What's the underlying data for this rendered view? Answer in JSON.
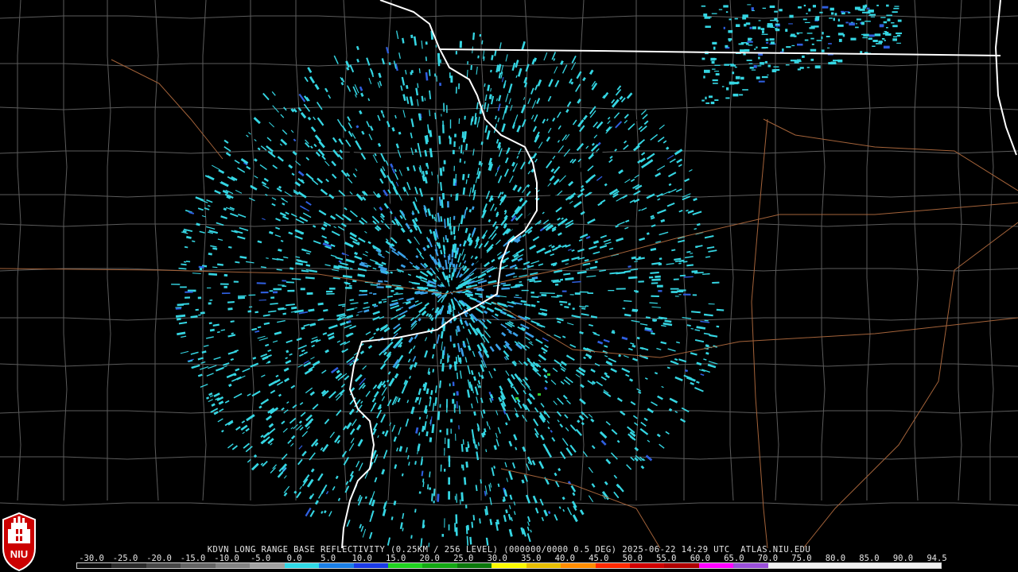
{
  "product": {
    "caption": "KDVN LONG RANGE BASE REFLECTIVITY (0.25KM / 256 LEVEL) (000000/0000 0.5 DEG) 2025-06-22 14:29 UTC  ATLAS.NIU.EDU"
  },
  "scale": {
    "labels": [
      "-30.0",
      "-25.0",
      "-20.0",
      "-15.0",
      "-10.0",
      "-5.0",
      "0.0",
      "5.0",
      "10.0",
      "15.0",
      "20.0",
      "25.0",
      "30.0",
      "35.0",
      "40.0",
      "45.0",
      "50.0",
      "55.0",
      "60.0",
      "65.0",
      "70.0",
      "75.0",
      "80.0",
      "85.0",
      "90.0",
      "94.5"
    ],
    "colors": [
      "#0d0d0d",
      "#2a2a2a",
      "#474747",
      "#646464",
      "#828282",
      "#a0a0a0",
      "#2fd8e6",
      "#1a7fe6",
      "#1a3be6",
      "#1fd21f",
      "#12a812",
      "#0a780a",
      "#fafa00",
      "#e6be00",
      "#ff8c00",
      "#ff2a00",
      "#d10000",
      "#b00000",
      "#ff00ff",
      "#9a4ed8",
      "#f0f0f0",
      "#f0f0f0",
      "#f0f0f0",
      "#f0f0f0",
      "#f0f0f0"
    ]
  },
  "logo": {
    "text": "NIU"
  },
  "map_colors": {
    "background": "#000000",
    "county_lines": "#5c5c5c",
    "state_lines": "#ffffff",
    "highways": "#a4633a",
    "echo_light": "#35d6e3",
    "echo_mid": "#3aa0e8",
    "echo_strong": "#2f5fe0",
    "echo_green": "#33cc33"
  }
}
